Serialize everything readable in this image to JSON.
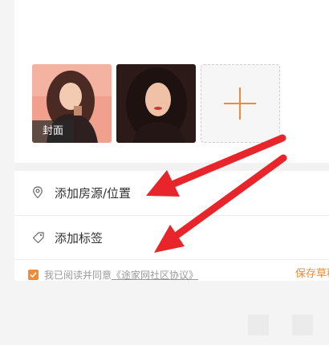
{
  "photos": {
    "cover_label": "封面",
    "items": [
      {
        "name": "photo-1",
        "tone": "#e88a7a"
      },
      {
        "name": "photo-2",
        "tone": "#3a2420"
      }
    ],
    "add_icon": "plus-icon"
  },
  "rows": {
    "location": {
      "label": "添加房源/位置",
      "icon": "location-pin-icon"
    },
    "tags": {
      "label": "添加标签",
      "icon": "tag-icon"
    }
  },
  "agreement": {
    "checked": true,
    "prefix": "我已阅读并同意",
    "link": "《途家网社区协议》"
  },
  "save_draft": "保存草稿",
  "colors": {
    "accent": "#f08a36",
    "annotation_arrow": "#e8252a",
    "text": "#333333",
    "muted": "#9a9a9a"
  }
}
